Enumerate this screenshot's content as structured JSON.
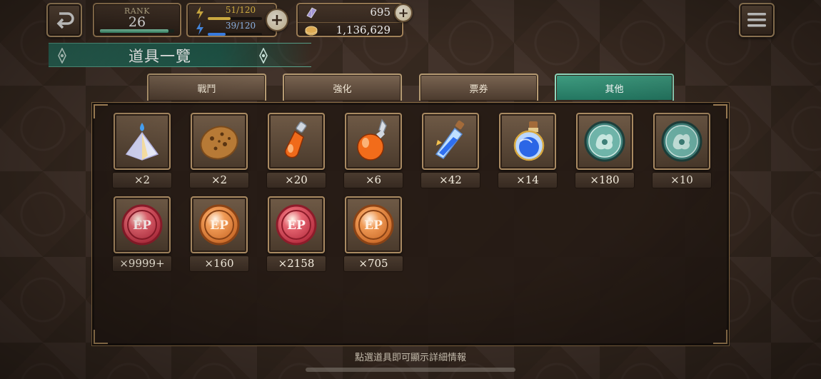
{
  "hud": {
    "rank_label": "RANK",
    "rank_value": "26",
    "rank_progress": 0.92,
    "stamina_yellow": "51/120",
    "stamina_blue": "39/120",
    "gems": "695",
    "gold": "1,136,629"
  },
  "title": "道具一覽",
  "tabs": [
    {
      "label": "戰鬥",
      "active": false
    },
    {
      "label": "強化",
      "active": false
    },
    {
      "label": "票券",
      "active": false
    },
    {
      "label": "其他",
      "active": true
    }
  ],
  "items": [
    {
      "icon": "crystal-pyramid-icon",
      "count": "×2"
    },
    {
      "icon": "cookie-icon",
      "count": "×2"
    },
    {
      "icon": "small-orange-potion-icon",
      "count": "×20"
    },
    {
      "icon": "large-orange-potion-icon",
      "count": "×6"
    },
    {
      "icon": "blue-elixir-vial-icon",
      "count": "×42"
    },
    {
      "icon": "blue-elixir-flask-icon",
      "count": "×14"
    },
    {
      "icon": "teal-medal-icon",
      "count": "×180"
    },
    {
      "icon": "teal-medal-icon",
      "count": "×10"
    },
    {
      "icon": "red-coin-icon",
      "count": "×9999+"
    },
    {
      "icon": "bronze-coin-icon",
      "count": "×160"
    },
    {
      "icon": "red-coin-icon",
      "count": "×2158"
    },
    {
      "icon": "bronze-coin-icon",
      "count": "×705"
    }
  ],
  "hint": "點選道具即可顯示詳細情報",
  "colors": {
    "active_tab": "#2f8a70",
    "banner": "#24604f",
    "panel_border": "#8f7048"
  }
}
